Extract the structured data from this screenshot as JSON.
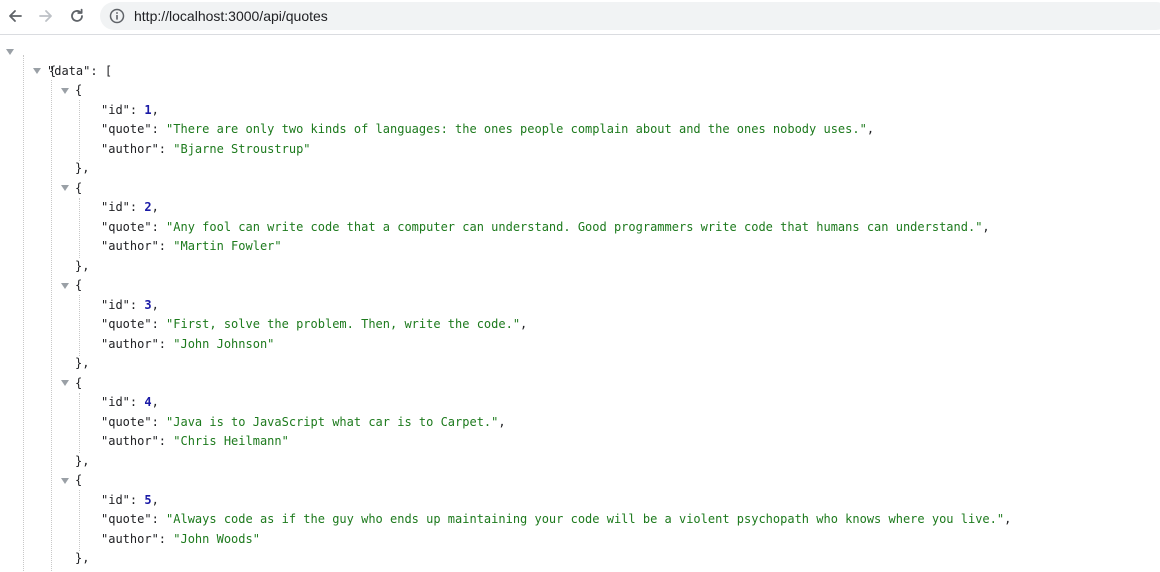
{
  "browser": {
    "url": "http://localhost:3000/api/quotes"
  },
  "json": {
    "root_open": "{",
    "data_key": "\"data\"",
    "colon": ": ",
    "array_open": "[",
    "obj_open": "{",
    "obj_close": "},",
    "key_id": "\"id\"",
    "key_quote": "\"quote\"",
    "key_author": "\"author\"",
    "comma": ",",
    "items": [
      {
        "id": "1",
        "quote": "\"There are only two kinds of languages: the ones people complain about and the ones nobody uses.\"",
        "author": "\"Bjarne Stroustrup\""
      },
      {
        "id": "2",
        "quote": "\"Any fool can write code that a computer can understand. Good programmers write code that humans can understand.\"",
        "author": "\"Martin Fowler\""
      },
      {
        "id": "3",
        "quote": "\"First, solve the problem. Then, write the code.\"",
        "author": "\"John Johnson\""
      },
      {
        "id": "4",
        "quote": "\"Java is to JavaScript what car is to Carpet.\"",
        "author": "\"Chris Heilmann\""
      },
      {
        "id": "5",
        "quote": "\"Always code as if the guy who ends up maintaining your code will be a violent psychopath who knows where you live.\"",
        "author": "\"John Woods\""
      }
    ]
  }
}
